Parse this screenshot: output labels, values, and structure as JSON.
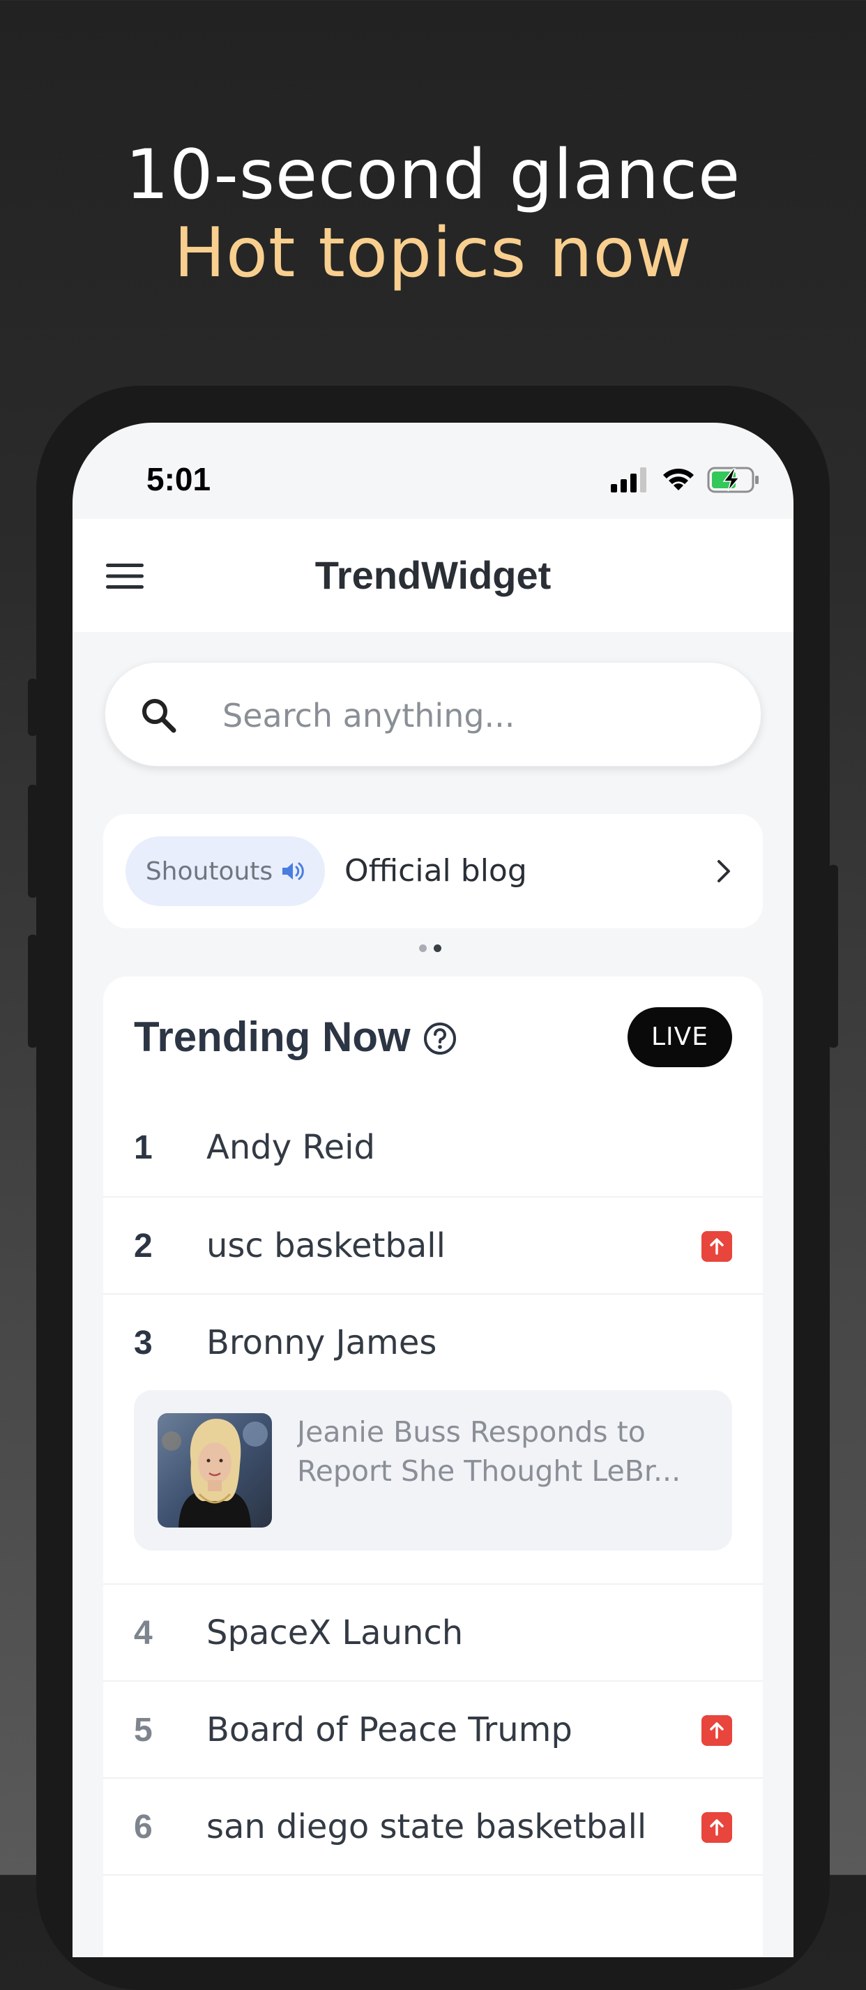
{
  "hero": {
    "line1": "10-second glance",
    "line2": "Hot topics now"
  },
  "status_bar": {
    "time": "5:01",
    "icons": [
      "cellular-signal-icon",
      "wifi-icon",
      "battery-charging-icon"
    ]
  },
  "app_bar": {
    "title": "TrendWidget",
    "menu_icon": "hamburger-menu-icon"
  },
  "search": {
    "placeholder": "Search anything...",
    "value": "",
    "icon": "search-icon"
  },
  "shoutout": {
    "pill_label": "Shoutouts",
    "pill_icon": "speaker-icon",
    "text": "Official blog",
    "chevron_icon": "chevron-right-icon",
    "page_count": 2,
    "active_page": 2
  },
  "trending": {
    "title": "Trending Now",
    "help_icon": "help-circle-icon",
    "badge": "LIVE",
    "items": [
      {
        "rank": "1",
        "topic": "Andy Reid",
        "rising": false
      },
      {
        "rank": "2",
        "topic": "usc basketball",
        "rising": true
      },
      {
        "rank": "3",
        "topic": "Bronny James",
        "rising": false
      },
      {
        "rank": "4",
        "topic": "SpaceX Launch",
        "rising": false
      },
      {
        "rank": "5",
        "topic": "Board of Peace Trump",
        "rising": true
      },
      {
        "rank": "6",
        "topic": "san diego state basketball",
        "rising": true
      }
    ],
    "news": {
      "line1": "Jeanie Buss Responds to",
      "line2": "Report She Thought LeBr..."
    }
  },
  "colors": {
    "background_top": "#222222",
    "hero_accent": "#f9cf8f",
    "screen_bg": "#f5f6f8",
    "rising_badge": "#e8453c",
    "live_badge": "#0a0a0a",
    "shoutout_pill": "#e8eefb",
    "speaker_accent": "#4a7de0"
  }
}
